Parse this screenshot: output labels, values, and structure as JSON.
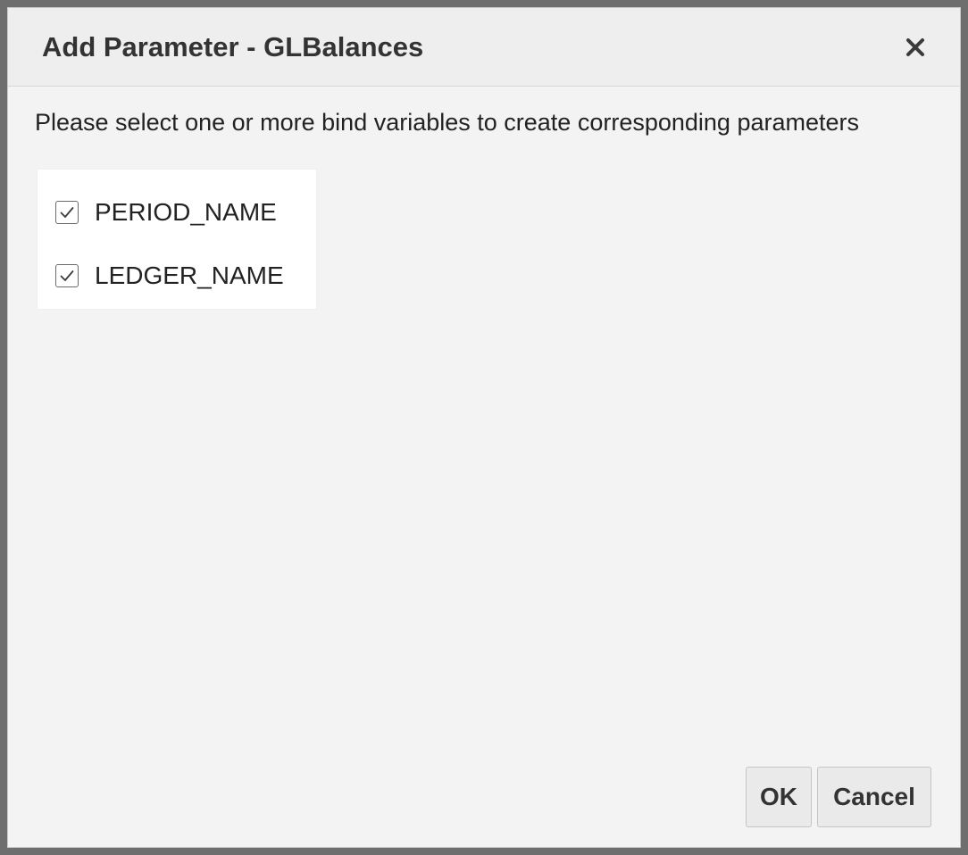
{
  "dialog": {
    "title": "Add Parameter - GLBalances",
    "close_icon": "close-icon"
  },
  "instructions": "Please select one or more bind variables to create corresponding parameters",
  "bind_variables": [
    {
      "label": "PERIOD_NAME",
      "checked": true
    },
    {
      "label": "LEDGER_NAME",
      "checked": true
    }
  ],
  "buttons": {
    "ok_label": "OK",
    "cancel_label": "Cancel"
  },
  "colors": {
    "dialog_bg": "#f3f3f3",
    "header_bg": "#eeeeee",
    "text": "#222222"
  }
}
